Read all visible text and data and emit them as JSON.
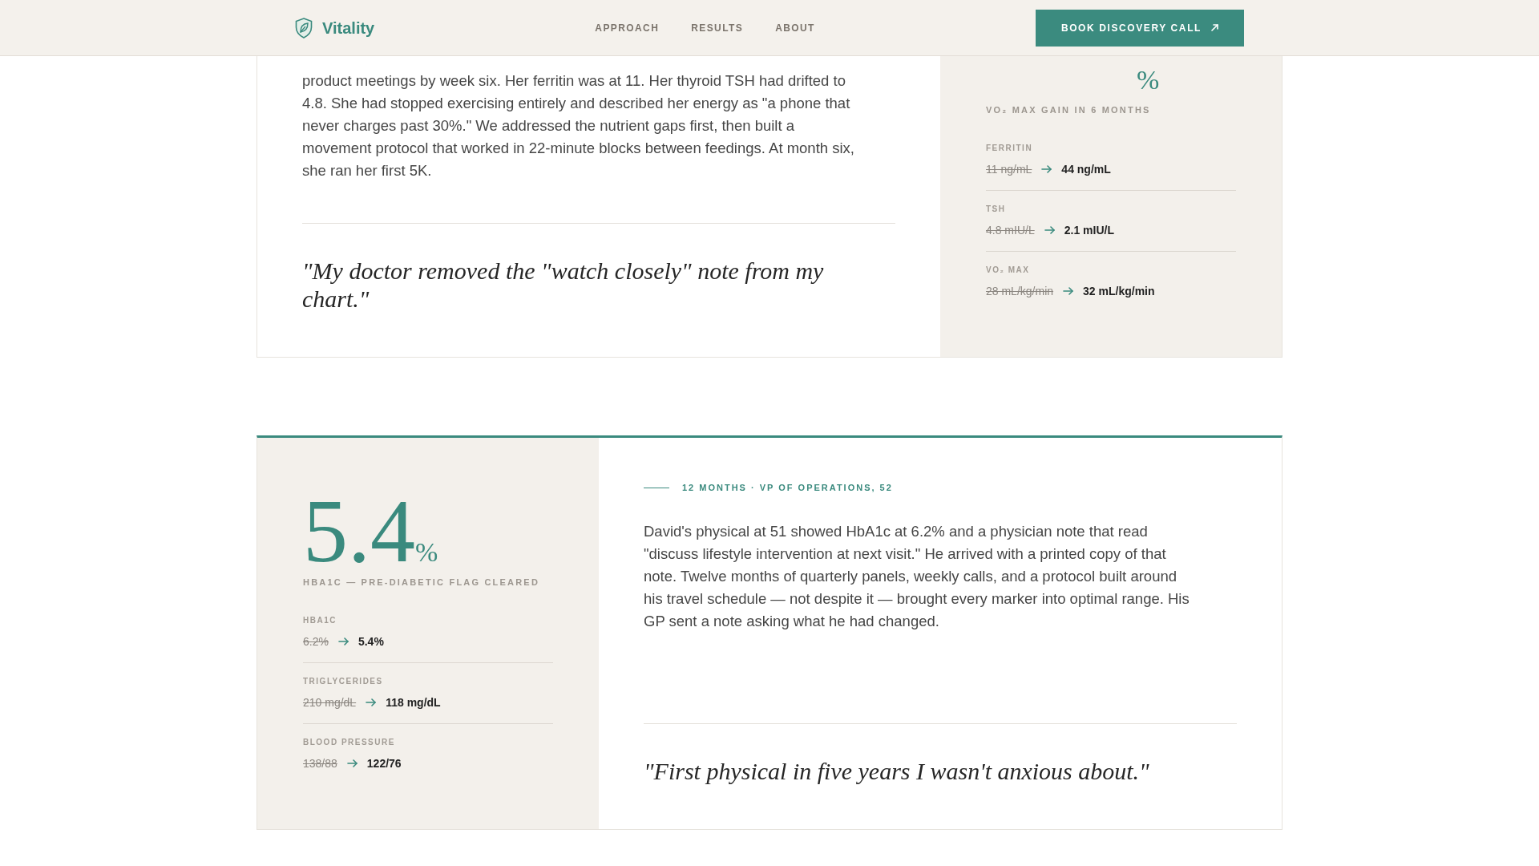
{
  "header": {
    "brand": "Vitality",
    "nav": [
      {
        "label": "APPROACH"
      },
      {
        "label": "RESULTS"
      },
      {
        "label": "ABOUT"
      }
    ],
    "cta": "BOOK DISCOVERY CALL"
  },
  "case_studies": [
    {
      "stats_first": false,
      "story": "product meetings by week six. Her ferritin was at 11. Her thyroid TSH had drifted to 4.8. She had stopped exercising entirely and described her energy as \"a phone that never charges past 30%.\" We addressed the nutrient gaps first, then built a movement protocol that worked in 22-minute blocks between feedings. At month six, she ran her first 5K.",
      "quote": "\"My doctor removed the \"watch closely\" note from my chart.\"",
      "stat": {
        "unit": "%",
        "caption": "VO₂ MAX GAIN IN 6 MONTHS"
      },
      "metrics": [
        {
          "label": "FERRITIN",
          "before": "11 ng/mL",
          "after": "44 ng/mL"
        },
        {
          "label": "TSH",
          "before": "4.8 mIU/L",
          "after": "2.1 mIU/L"
        },
        {
          "label": "VO₂ MAX",
          "before": "28 mL/kg/min",
          "after": "32 mL/kg/min"
        }
      ]
    },
    {
      "stats_first": true,
      "eyebrow": "12 MONTHS · VP OF OPERATIONS, 52",
      "story": "David's physical at 51 showed HbA1c at 6.2% and a physician note that read \"discuss lifestyle intervention at next visit.\" He arrived with a printed copy of that note. Twelve months of quarterly panels, weekly calls, and a protocol built around his travel schedule — not despite it — brought every marker into optimal range. His GP sent a note asking what he had changed.",
      "quote": "\"First physical in five years I wasn't anxious about.\"",
      "stat": {
        "value": "5.4",
        "unit": "%",
        "caption": "HBA1C — PRE-DIABETIC FLAG CLEARED"
      },
      "metrics": [
        {
          "label": "HBA1C",
          "before": "6.2%",
          "after": "5.4%"
        },
        {
          "label": "TRIGLYCERIDES",
          "before": "210 mg/dL",
          "after": "118 mg/dL"
        },
        {
          "label": "BLOOD PRESSURE",
          "before": "138/88",
          "after": "122/76"
        }
      ]
    }
  ]
}
